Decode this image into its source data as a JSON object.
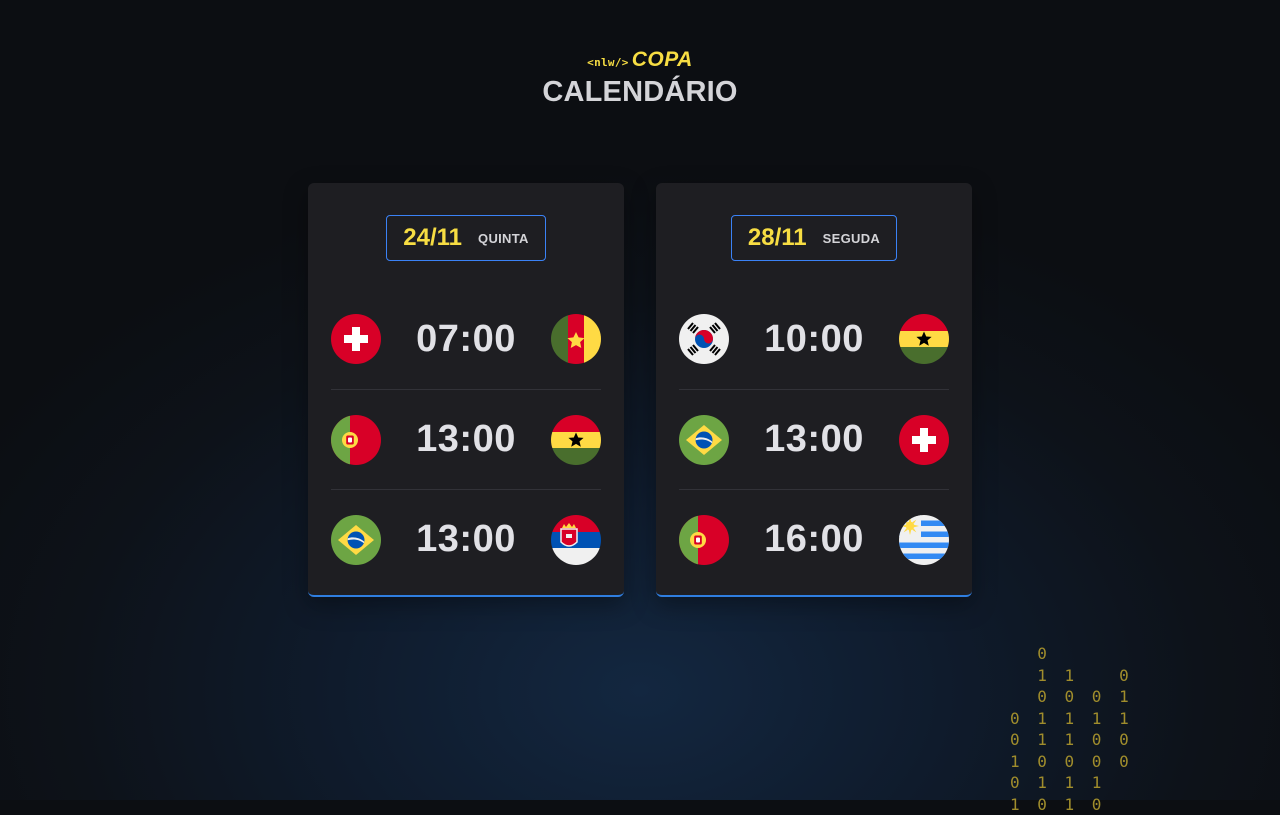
{
  "header": {
    "logo_tag": "<nlw/>",
    "logo_word": "COPA",
    "title": "CALENDÁRIO"
  },
  "cards": [
    {
      "date": "24/11",
      "weekday": "QUINTA",
      "matches": [
        {
          "time": "07:00",
          "home": "switzerland-flag-icon",
          "away": "cameroon-flag-icon"
        },
        {
          "time": "13:00",
          "home": "portugal-flag-icon",
          "away": "ghana-flag-icon"
        },
        {
          "time": "13:00",
          "home": "brazil-flag-icon",
          "away": "serbia-flag-icon"
        }
      ]
    },
    {
      "date": "28/11",
      "weekday": "SEGUDA",
      "matches": [
        {
          "time": "10:00",
          "home": "south-korea-flag-icon",
          "away": "ghana-flag-icon"
        },
        {
          "time": "13:00",
          "home": "brazil-flag-icon",
          "away": "switzerland-flag-icon"
        },
        {
          "time": "16:00",
          "home": "portugal-flag-icon",
          "away": "uruguay-flag-icon"
        }
      ]
    }
  ],
  "decoration": {
    "binary_text": "  0\n  1 1   0\n  0 0 0 1\n0 1 1 1 1\n0 1 1 0 0\n1 0 0 0 0\n0 1 1 1\n1 0 1 0"
  },
  "colors": {
    "accent_yellow": "#f7dd43",
    "accent_blue": "#3b82f6",
    "card_bg": "#1e1e22"
  }
}
